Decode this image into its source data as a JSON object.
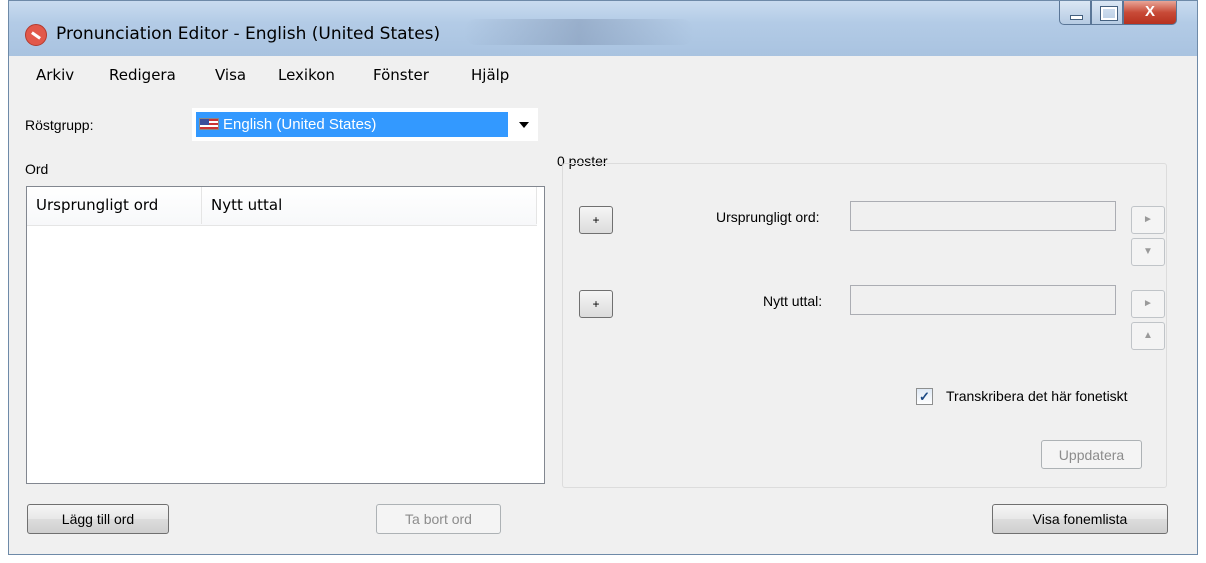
{
  "window": {
    "title": "Pronunciation Editor - English (United States)",
    "close_label": "X"
  },
  "menu": [
    {
      "label": "Arkiv"
    },
    {
      "label": "Redigera"
    },
    {
      "label": "Visa"
    },
    {
      "label": "Lexikon"
    },
    {
      "label": "Fönster"
    },
    {
      "label": "Hjälp"
    }
  ],
  "voice_group": {
    "label": "Röstgrupp:",
    "selected": "English (United States)"
  },
  "word_list": {
    "label": "Ord",
    "columns": [
      "Ursprungligt ord",
      "Nytt uttal"
    ],
    "rows": []
  },
  "entry_count": "0 poster",
  "editor": {
    "original_word_label": "Ursprungligt ord:",
    "original_word_value": "",
    "new_pronunciation_label": "Nytt uttal:",
    "new_pronunciation_value": "",
    "plus_label": "+",
    "arrow_right": "►",
    "arrow_down": "▼",
    "arrow_up": "▲",
    "transcribe_label": "Transkribera det här fonetiskt",
    "transcribe_checked": true,
    "checkmark": "✓",
    "update_button": "Uppdatera"
  },
  "buttons": {
    "add_word": "Lägg till ord",
    "remove_word": "Ta bort ord",
    "show_phoneme_list": "Visa fonemlista"
  }
}
